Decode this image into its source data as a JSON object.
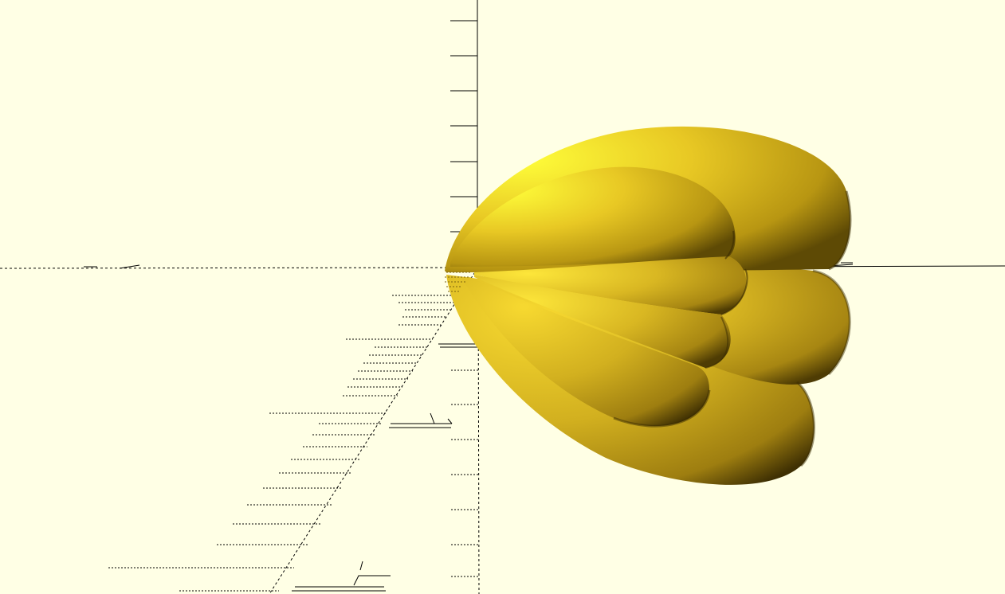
{
  "viewport": {
    "background_color": "#ffffe5",
    "model_color": "#f5d72a",
    "axis_color": "#000000",
    "model_shape": "lobed-ellipsoid-petals"
  }
}
